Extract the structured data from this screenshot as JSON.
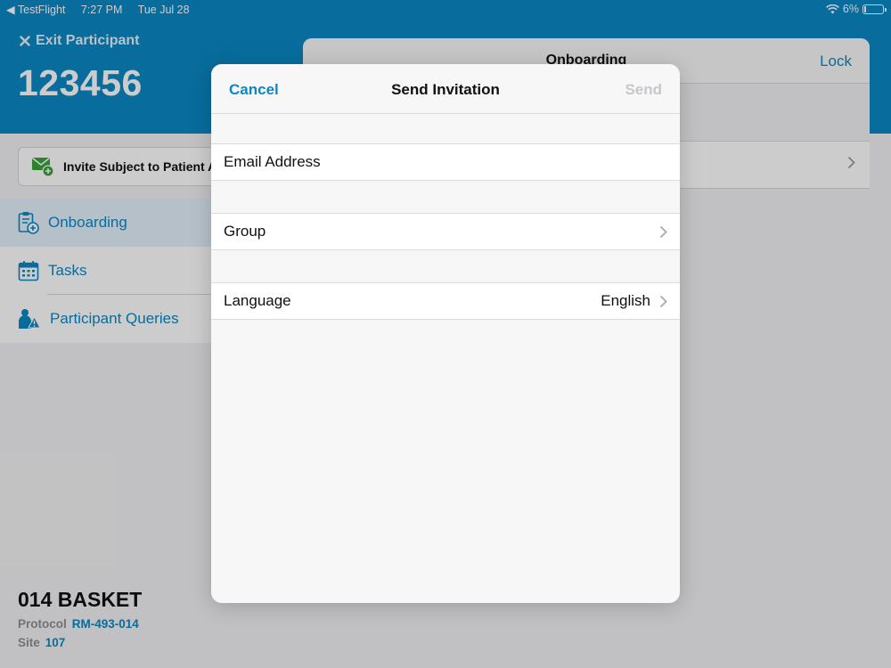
{
  "status_bar": {
    "back_app": "TestFlight",
    "time": "7:27 PM",
    "date": "Tue Jul 28",
    "battery": "6%"
  },
  "header": {
    "exit_label": "Exit Participant",
    "participant_id": "123456"
  },
  "sidebar": {
    "invite_label": "Invite Subject to Patient A",
    "items": [
      {
        "label": "Onboarding",
        "icon": "clipboard-add-icon",
        "active": true
      },
      {
        "label": "Tasks",
        "icon": "calendar-icon",
        "active": false
      },
      {
        "label": "Participant Queries",
        "icon": "person-warning-icon",
        "active": false
      }
    ],
    "study_name": "014 BASKET",
    "protocol_label": "Protocol",
    "protocol_value": "RM-493-014",
    "site_label": "Site",
    "site_value": "107"
  },
  "detail": {
    "title": "Onboarding",
    "lock_label": "Lock"
  },
  "modal": {
    "cancel_label": "Cancel",
    "title": "Send Invitation",
    "send_label": "Send",
    "email_placeholder": "Email Address",
    "group_label": "Group",
    "language_label": "Language",
    "language_value": "English"
  },
  "colors": {
    "brand_blue": "#0b87c4",
    "disabled_gray": "#c7c7cc"
  }
}
